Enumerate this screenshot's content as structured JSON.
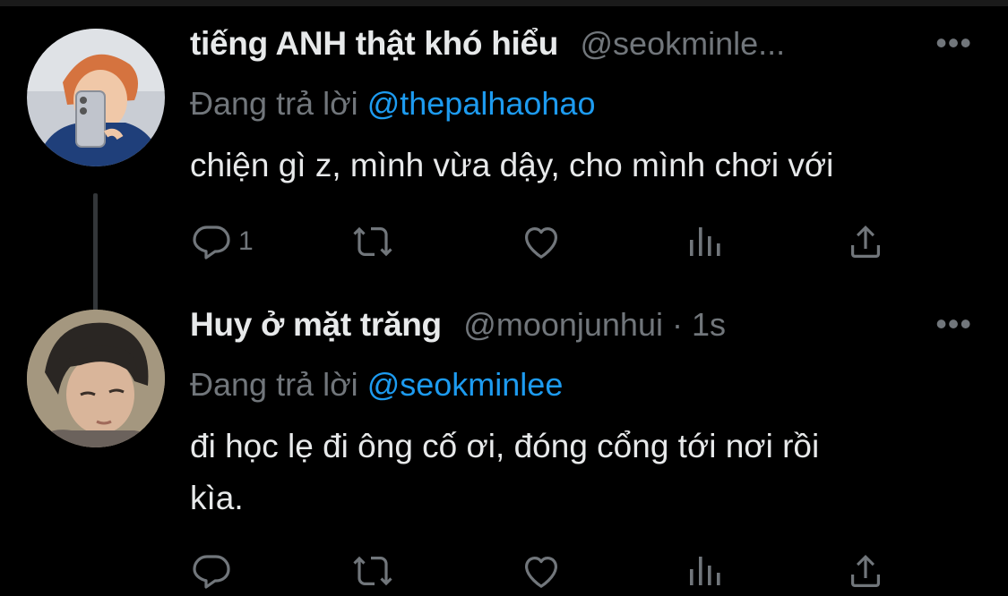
{
  "tweets": [
    {
      "display_name": "tiếng ANH thật khó hiểu",
      "handle": "@seokminle...",
      "time": "",
      "reply_label": "Đang trả lời",
      "reply_to": "@thepalhaohao",
      "text": "chiện gì z, mình vừa dậy, cho mình chơi với",
      "reply_count": "1",
      "more": "•••"
    },
    {
      "display_name": "Huy ở mặt trăng",
      "handle": "@moonjunhui · 1s",
      "reply_label": "Đang trả lời",
      "reply_to": "@seokminlee",
      "text_line1": "đi học lẹ đi ông cố ơi, đóng cổng tới nơi rồi",
      "text_line2": "kìa.",
      "reply_count": "",
      "more": "•••"
    }
  ],
  "colors": {
    "background": "#000000",
    "text": "#e7e9ea",
    "muted": "#71767b",
    "accent": "#1d9bf0",
    "thread_line": "#333639"
  },
  "icons": [
    "reply-icon",
    "retweet-icon",
    "like-icon",
    "analytics-icon",
    "share-icon"
  ]
}
